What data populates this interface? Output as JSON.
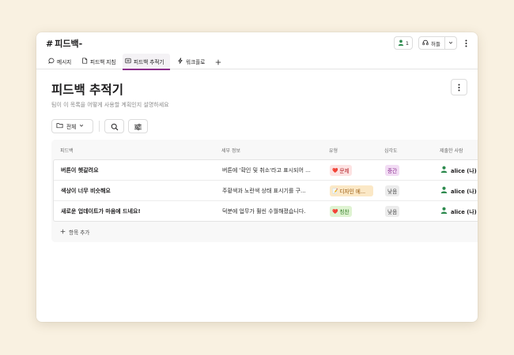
{
  "channel": {
    "hash": "#",
    "name": "피드백-"
  },
  "header": {
    "member_count": "1",
    "huddle_label": "허들"
  },
  "tabs": [
    {
      "label": "메시지",
      "icon": "message-bubble-icon"
    },
    {
      "label": "피드백 지침",
      "icon": "canvas-doc-icon"
    },
    {
      "label": "피드백 추적기",
      "icon": "list-icon",
      "active": true
    },
    {
      "label": "워크플로",
      "icon": "lightning-icon"
    }
  ],
  "page": {
    "title": "피드백 추적기",
    "description": "팀이 이 목록을 어떻게 사용할 계획인지 설명하세요"
  },
  "toolbar": {
    "view_label": "전체"
  },
  "table": {
    "columns": [
      "피드백",
      "세부 정보",
      "유형",
      "심각도",
      "제출한 사람"
    ],
    "rows": [
      {
        "title": "버튼이 헷갈려요",
        "detail": "버튼에 '확인 및 취소'라고 표시되어 ...",
        "type": {
          "label": "문제",
          "emoji": "❤️"
        },
        "severity": "중간",
        "submitter": "alice (나)"
      },
      {
        "title": "색상이 너무 비슷해요",
        "detail": "주황색과 노란색 상태 표시기를 구...",
        "type": {
          "label": "디자인 에...",
          "emoji": "📝"
        },
        "severity": "낮음",
        "submitter": "alice (나)"
      },
      {
        "title": "새로운 업데이트가 마음에 드네요!",
        "detail": "덕분에 업무가 훨씬 수월해졌습니다.",
        "type": {
          "label": "칭찬",
          "emoji": "❤️"
        },
        "severity": "낮음",
        "submitter": "alice (나)"
      }
    ],
    "add_label": "항목 추가"
  },
  "colors": {
    "background": "#f9f1e1",
    "active_tab_underline": "#8b2f8b",
    "tag_problem_bg": "#fde3e3",
    "tag_design_bg": "#fbe8c6",
    "tag_praise_bg": "#dff3d2",
    "severity_medium_bg": "#f2dcf4",
    "severity_low_bg": "#ececec",
    "user_icon": "#2d8a4e"
  }
}
